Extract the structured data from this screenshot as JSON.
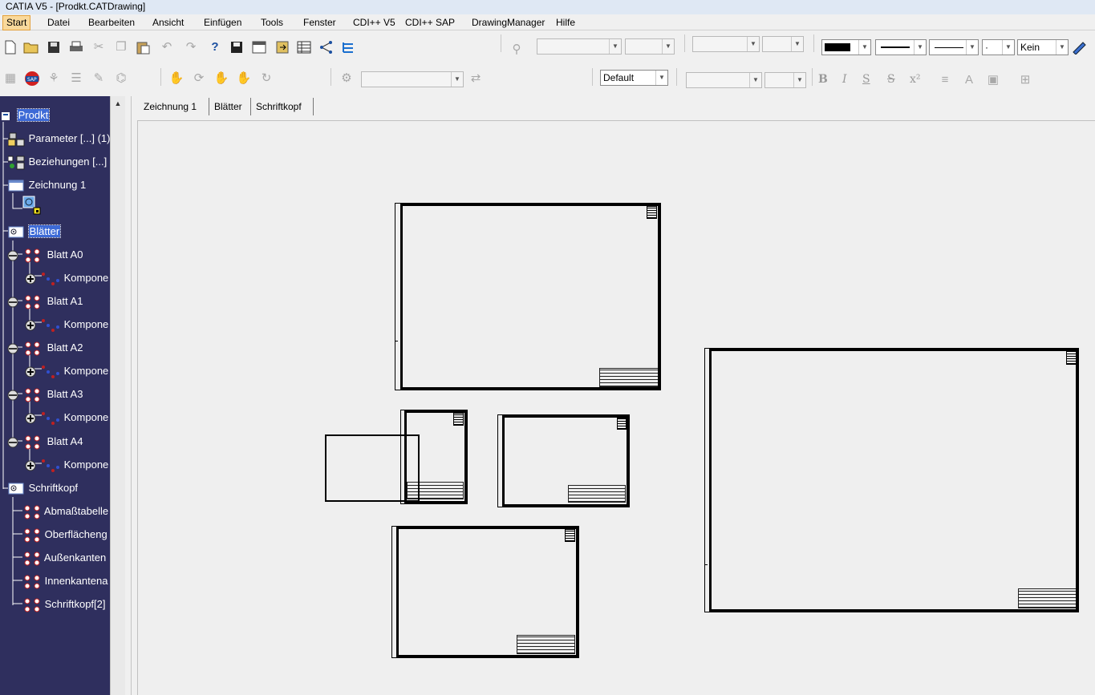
{
  "window": {
    "title": "CATIA V5 - [Prodkt.CATDrawing]"
  },
  "menu": {
    "items": [
      "Start",
      "Datei",
      "Bearbeiten",
      "Ansicht",
      "Einfügen",
      "Tools",
      "Fenster",
      "CDI++ V5",
      "CDI++ SAP",
      "DrawingManager",
      "Hilfe"
    ],
    "active": "Start"
  },
  "toolbar": {
    "style_combo": "Default",
    "fill_combo": "Kein"
  },
  "tree": {
    "root": "Prodkt",
    "parameters": "Parameter [...] (1)",
    "relations": "Beziehungen [...]",
    "drawing": "Zeichnung 1",
    "sheets": "Blätter",
    "sheet_a0": "Blatt A0",
    "sheet_a1": "Blatt A1",
    "sheet_a2": "Blatt A2",
    "sheet_a3": "Blatt A3",
    "sheet_a4": "Blatt A4",
    "component": "Kompone",
    "titleblock": "Schriftkopf",
    "tb_items": [
      "Abmaßtabelle",
      "Oberflächeng",
      "Außenkanten",
      "Innenkantena",
      "Schriftkopf[2]"
    ]
  },
  "tabs": [
    "Zeichnung 1",
    "Blätter",
    "Schriftkopf"
  ],
  "colors": {
    "tree_bg": "#2f2f5e",
    "selection": "#3d6ad6",
    "menu_active": "#f9d99b"
  }
}
